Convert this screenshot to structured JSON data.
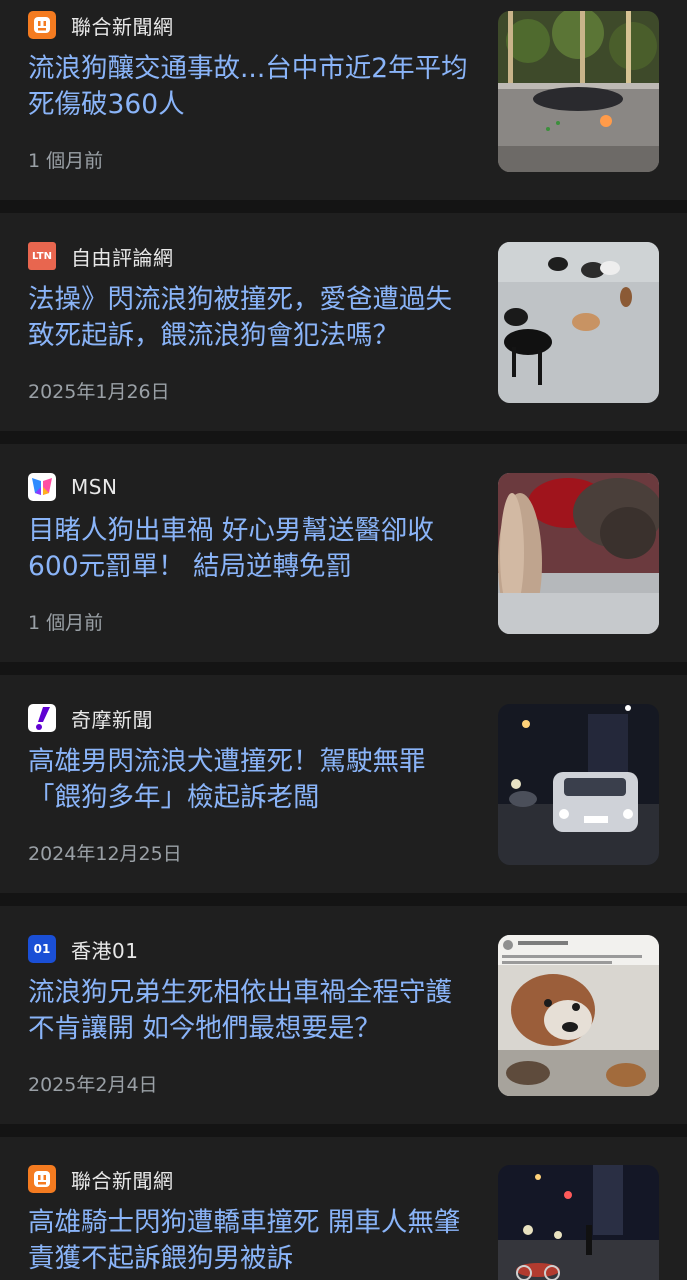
{
  "articles": [
    {
      "source": "聯合新聞網",
      "source_icon": "udn-outlet-icon",
      "headline": "流浪狗釀交通事故...台中市近2年平均死傷破360人",
      "meta": "1 個月前"
    },
    {
      "source": "自由評論網",
      "source_icon": "ltn-logo-icon",
      "logo_text": "LTN",
      "headline": "法操》閃流浪狗被撞死，愛爸遭過失致死起訴，餵流浪狗會犯法嗎？",
      "meta": "2025年1月26日"
    },
    {
      "source": "MSN",
      "source_icon": "msn-butterfly-icon",
      "headline": "目睹人狗出車禍 好心男幫送醫卻收600元罰單！ 結局逆轉免罰",
      "meta": "1 個月前"
    },
    {
      "source": "奇摩新聞",
      "source_icon": "yahoo-exclamation-icon",
      "headline": "高雄男閃流浪犬遭撞死！駕駛無罪「餵狗多年」檢起訴老闆",
      "meta": "2024年12月25日"
    },
    {
      "source": "香港01",
      "source_icon": "hk01-logo-icon",
      "logo_text": "01",
      "headline": "流浪狗兄弟生死相依出車禍全程守護不肯讓開 如今牠們最想要是？",
      "meta": "2025年2月4日"
    },
    {
      "source": "聯合新聞網",
      "source_icon": "udn-outlet-icon",
      "headline": "高雄騎士閃狗遭轎車撞死 開車人無肇責獲不起訴餵狗男被訴",
      "meta": ""
    }
  ],
  "colors": {
    "background": "#141414",
    "card": "#1f1f1f",
    "headline": "#8ab4f8",
    "source_text": "#e8e8e8",
    "meta_text": "#9aa0a6",
    "udn_orange": "#f47b20",
    "ltn_red": "#e8664f",
    "yahoo_purple": "#6001d2",
    "hk01_blue": "#1a4fd6"
  }
}
